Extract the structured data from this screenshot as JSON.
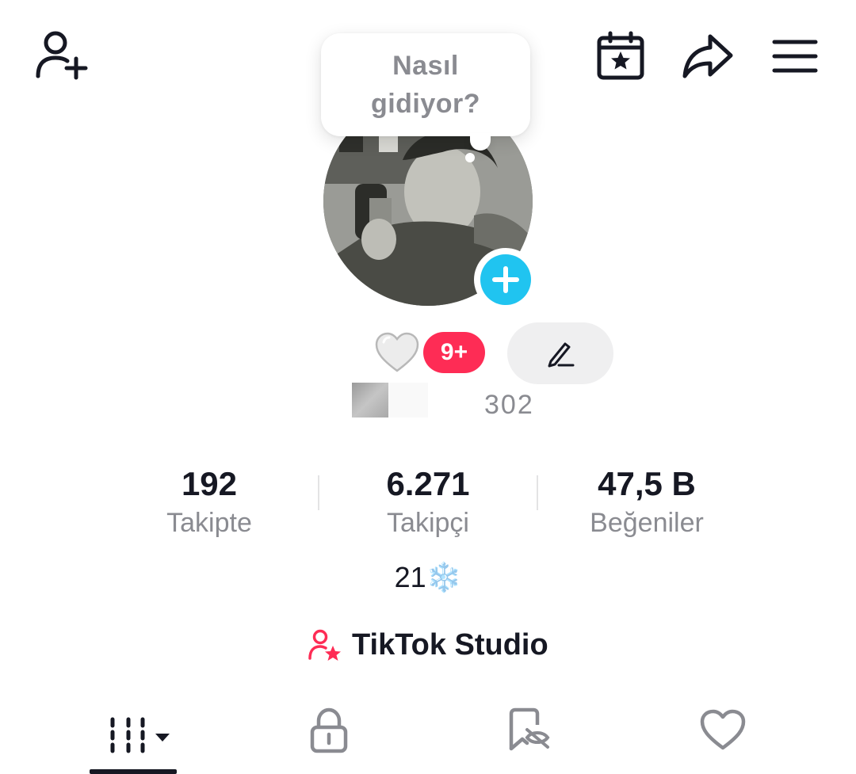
{
  "header": {
    "add_friend_icon": "person-plus-icon",
    "events_icon": "calendar-star-icon",
    "share_icon": "share-arrow-icon",
    "menu_icon": "hamburger-menu-icon"
  },
  "bubble": {
    "text": "Nasıl\ngidiyor?"
  },
  "profile": {
    "avatar_action_icon": "plus-icon",
    "status_emoji": "🤍",
    "notification_badge": "9+",
    "edit_icon": "pencil-icon",
    "username_fragment": "302"
  },
  "stats": [
    {
      "value": "192",
      "label": "Takipte"
    },
    {
      "value": "6.271",
      "label": "Takipçi"
    },
    {
      "value": "47,5 B",
      "label": "Beğeniler"
    }
  ],
  "bio": {
    "text": "21",
    "emoji": "❄️"
  },
  "studio": {
    "label": "TikTok Studio",
    "icon": "person-star-icon"
  },
  "tabs": [
    {
      "name": "videos",
      "icon": "grid-lines-icon"
    },
    {
      "name": "private",
      "icon": "lock-icon"
    },
    {
      "name": "reposts",
      "icon": "repost-hidden-icon"
    },
    {
      "name": "liked",
      "icon": "heart-outline-icon"
    }
  ],
  "colors": {
    "accent_red": "#fe2c55",
    "avatar_plus_blue": "#20c4f0",
    "text_primary": "#161823",
    "text_secondary": "#8a8b91"
  }
}
